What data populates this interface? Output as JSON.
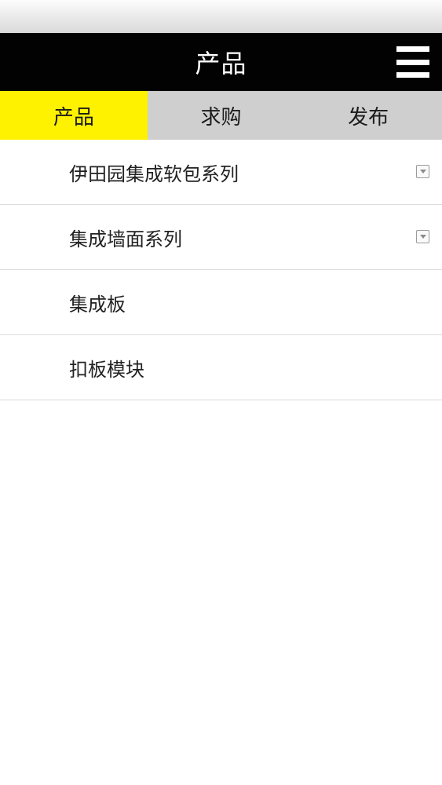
{
  "header": {
    "title": "产品",
    "menu_icon": "hamburger-menu-icon"
  },
  "tabs": [
    {
      "label": "产品",
      "active": true
    },
    {
      "label": "求购",
      "active": false
    },
    {
      "label": "发布",
      "active": false
    }
  ],
  "categories": [
    {
      "label": "伊田园集成软包系列",
      "expandable": true
    },
    {
      "label": "集成墙面系列",
      "expandable": true
    },
    {
      "label": "集成板",
      "expandable": false
    },
    {
      "label": "扣板模块",
      "expandable": false
    }
  ],
  "colors": {
    "header_bg": "#020202",
    "active_tab": "#fff200",
    "inactive_tab": "#cfcfcf"
  }
}
